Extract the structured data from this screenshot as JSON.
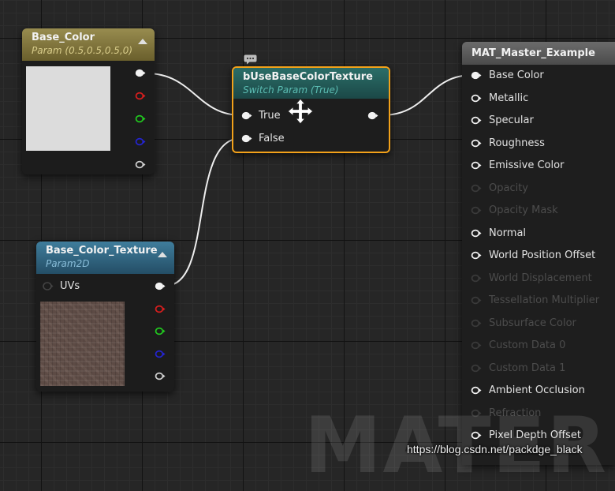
{
  "colors": {
    "vector_pin": "#f2f2f2",
    "channel_r": "#d81e1e",
    "channel_g": "#21c81f",
    "channel_b": "#2424d0",
    "channel_a": "#d0d0d0",
    "selection_outline": "#f2a11a",
    "base_color_swatch": "#dcdcdc",
    "texture_swatch": "#5e4c46",
    "wire": "#eeeeee",
    "disabled_pin": "#3a3a3a"
  },
  "base_color_node": {
    "title": "Base_Color",
    "subtitle": "Param (0.5,0.5,0.5,0)",
    "outputs": [
      {
        "icon": "rgba-output-pin",
        "color": "#f2f2f2"
      },
      {
        "icon": "red-channel-pin",
        "color": "#d81e1e"
      },
      {
        "icon": "green-channel-pin",
        "color": "#21c81f"
      },
      {
        "icon": "blue-channel-pin",
        "color": "#2424d0"
      },
      {
        "icon": "alpha-channel-pin",
        "color": "#d0d0d0"
      }
    ]
  },
  "texture_node": {
    "title": "Base_Color_Texture",
    "subtitle": "Param2D",
    "input_label": "UVs"
  },
  "switch_node": {
    "title": "bUseBaseColorTexture",
    "subtitle": "Switch Param (True)",
    "true_label": "True",
    "false_label": "False"
  },
  "master_node": {
    "title": "MAT_Master_Example",
    "inputs": [
      {
        "label": "Base Color",
        "enabled": true,
        "connected": true
      },
      {
        "label": "Metallic",
        "enabled": true,
        "connected": false
      },
      {
        "label": "Specular",
        "enabled": true,
        "connected": false
      },
      {
        "label": "Roughness",
        "enabled": true,
        "connected": false
      },
      {
        "label": "Emissive Color",
        "enabled": true,
        "connected": false
      },
      {
        "label": "Opacity",
        "enabled": false,
        "connected": false
      },
      {
        "label": "Opacity Mask",
        "enabled": false,
        "connected": false
      },
      {
        "label": "Normal",
        "enabled": true,
        "connected": false
      },
      {
        "label": "World Position Offset",
        "enabled": true,
        "connected": false
      },
      {
        "label": "World Displacement",
        "enabled": false,
        "connected": false
      },
      {
        "label": "Tessellation Multiplier",
        "enabled": false,
        "connected": false
      },
      {
        "label": "Subsurface Color",
        "enabled": false,
        "connected": false
      },
      {
        "label": "Custom Data 0",
        "enabled": false,
        "connected": false
      },
      {
        "label": "Custom Data 1",
        "enabled": false,
        "connected": false
      },
      {
        "label": "Ambient Occlusion",
        "enabled": true,
        "connected": false
      },
      {
        "label": "Refraction",
        "enabled": false,
        "connected": false
      },
      {
        "label": "Pixel Depth Offset",
        "enabled": true,
        "connected": false
      }
    ]
  },
  "watermark": {
    "material_text": "MATERIAL",
    "url": "https://blog.csdn.net/packdge_black"
  }
}
